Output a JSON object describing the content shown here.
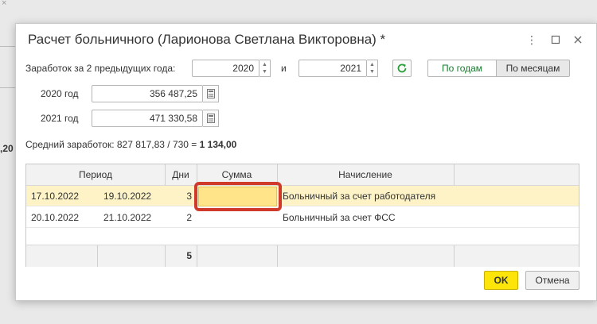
{
  "background": {
    "corner_glyph": "×",
    "partial_number": ",20"
  },
  "dialog": {
    "title": "Расчет больничного (Ларионова Светлана Викторовна) *",
    "window_controls": {
      "menu_icon": "more-vertical-icon",
      "maximize_icon": "maximize-icon",
      "close_icon": "close-icon"
    }
  },
  "earnings_form": {
    "label": "Заработок за 2 предыдущих года:",
    "year_from": "2020",
    "and_label": "и",
    "year_to": "2021",
    "mode_toggle": {
      "by_years": "По годам",
      "by_months": "По месяцам",
      "selected": "По годам"
    },
    "year_rows": [
      {
        "label": "2020 год",
        "value": "356 487,25"
      },
      {
        "label": "2021 год",
        "value": "471 330,58"
      }
    ],
    "average_text": "Средний заработок: 827 817,83 / 730 = ",
    "average_result": "1 134,00"
  },
  "grid": {
    "headers": {
      "period": "Период",
      "days": "Дни",
      "sum": "Сумма",
      "accrual": "Начисление"
    },
    "rows": [
      {
        "from": "17.10.2022",
        "to": "19.10.2022",
        "days": "3",
        "sum": "",
        "accrual": "Больничный за счет работодателя"
      },
      {
        "from": "20.10.2022",
        "to": "21.10.2022",
        "days": "2",
        "sum": "",
        "accrual": "Больничный за счет ФСС"
      }
    ],
    "total_days": "5"
  },
  "buttons": {
    "ok": "OK",
    "cancel": "Отмена"
  },
  "colors": {
    "ok_button": "#fde50a",
    "selected_row": "#fdf3c7",
    "highlight": "#d03a2a",
    "toggle_active_text": "#1a7a2e",
    "refresh_icon": "#2a9d3a"
  }
}
